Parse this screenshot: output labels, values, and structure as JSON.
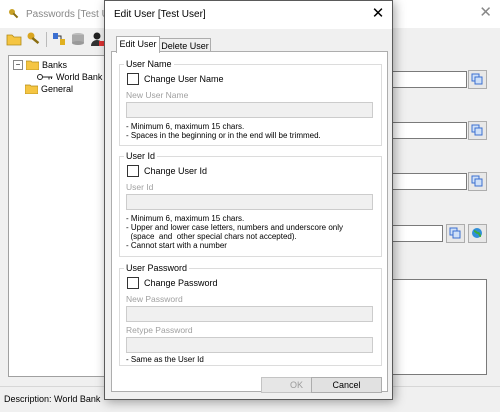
{
  "main_window": {
    "title": "Passwords [Test User]",
    "close_glyph": "✕",
    "toolbar_icons": [
      "folder-icon",
      "keys-icon",
      "connect-icon",
      "database-icon",
      "user-icon"
    ],
    "tree": {
      "items": [
        {
          "label": "Banks",
          "level": 0,
          "expander": "−",
          "icon": "folder-icon"
        },
        {
          "label": "World Bank",
          "level": 1,
          "icon": "key-icon"
        },
        {
          "label": "General",
          "level": 0,
          "icon": "folder-icon"
        }
      ]
    },
    "status": "Description: World Bank"
  },
  "dialog": {
    "title": "Edit User [Test User]",
    "close_glyph": "✕",
    "tabs": [
      {
        "label": "Edit User",
        "active": true
      },
      {
        "label": "Delete User",
        "active": false
      }
    ],
    "user_name": {
      "group_title": "User Name",
      "checkbox_label": "Change User Name",
      "field_label": "New User Name",
      "field_value": "",
      "notes": [
        "- Minimum 6, maximum 15 chars.",
        "- Spaces in the beginning or in the end will be trimmed."
      ]
    },
    "user_id": {
      "group_title": "User Id",
      "checkbox_label": "Change User Id",
      "field_label": "User Id",
      "field_value": "",
      "notes": [
        "- Minimum 6, maximum 15 chars.",
        "- Upper and lower case letters, numbers and underscore only",
        "  (space  and  other special chars not accepted).",
        "- Cannot start with a number"
      ]
    },
    "user_password": {
      "group_title": "User Password",
      "checkbox_label": "Change Password",
      "new_password_label": "New Password",
      "retype_password_label": "Retype Password",
      "notes": [
        "- Same as the User Id"
      ]
    },
    "buttons": {
      "ok": "OK",
      "cancel": "Cancel"
    }
  },
  "colors": {
    "window_bg": "#f0f0f0",
    "panel_bg": "#ffffff",
    "disabled_text": "#a0a0a0"
  }
}
